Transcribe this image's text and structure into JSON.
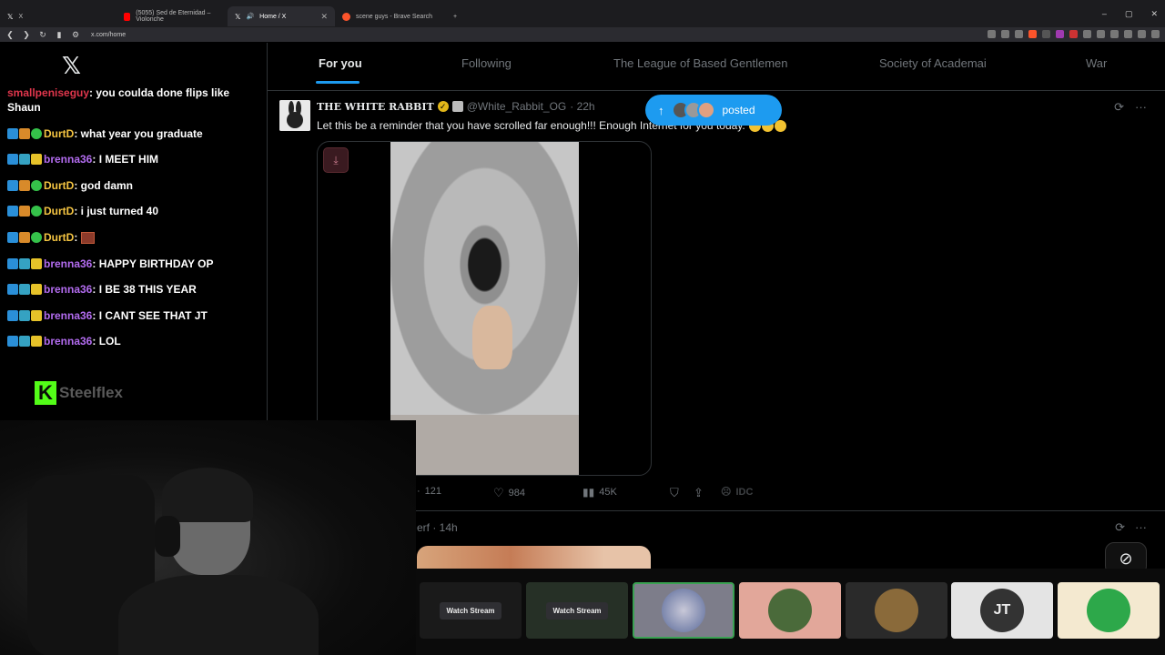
{
  "browser": {
    "tabs": [
      {
        "label": "X",
        "favicon_color": "#000000",
        "active": false
      },
      {
        "label": "(5055) Sed de Eternidad – Violonche",
        "favicon_color": "#ff0000",
        "active": false
      },
      {
        "label": "Home / X",
        "favicon_color": "#000000",
        "active": true
      },
      {
        "label": "scene guys - Brave Search",
        "favicon_color": "#fb542b",
        "active": false
      }
    ],
    "new_tab": "+",
    "url": "x.com/home"
  },
  "chat": {
    "platform": "Steelflex",
    "messages": [
      {
        "user": "smallpeniseguy",
        "text": ": you coulda done flips like",
        "user_color": "#e0364c"
      },
      {
        "user": "",
        "text": "Shaun",
        "user_color": "#ffffff"
      },
      {
        "user": "DurtD",
        "text": ": what year you graduate",
        "user_color": "#f5c542"
      },
      {
        "user": "brenna36",
        "text": ": I MEET HIM",
        "user_color": "#b36cf0"
      },
      {
        "user": "DurtD",
        "text": ": god damn",
        "user_color": "#f5c542"
      },
      {
        "user": "DurtD",
        "text": ": i just turned 40",
        "user_color": "#f5c542"
      },
      {
        "user": "DurtD",
        "text": ":",
        "user_color": "#f5c542"
      },
      {
        "user": "brenna36",
        "text": ": HAPPY BIRTHDAY OP",
        "user_color": "#b36cf0"
      },
      {
        "user": "brenna36",
        "text": ": I BE 38 THIS YEAR",
        "user_color": "#b36cf0"
      },
      {
        "user": "brenna36",
        "text": ": I CANT SEE THAT JT",
        "user_color": "#b36cf0"
      },
      {
        "user": "brenna36",
        "text": ": LOL",
        "user_color": "#b36cf0"
      }
    ]
  },
  "x": {
    "tabs": [
      "For you",
      "Following",
      "The League of Based Gentlemen",
      "Society of Academai",
      "War"
    ],
    "active_tab": "For you",
    "posted_pill": "posted",
    "tweet": {
      "name": "THE WHITE RABBIT",
      "handle": "@White_Rabbit_OG",
      "time": "· 22h",
      "text": "Let this be a reminder that you have scrolled far enough!!! Enough Internet for you today.",
      "replies": "121",
      "likes": "984",
      "views": "45K",
      "idc": "IDC"
    },
    "tweet2": {
      "head": "erf · 14h"
    }
  },
  "stream_bar": {
    "watch_label": "Watch Stream",
    "thumbs": [
      {
        "kind": "watch",
        "bg": "#1a1a1a"
      },
      {
        "kind": "watch",
        "bg": "#263026"
      },
      {
        "kind": "circle",
        "bg": "#7d7d8a",
        "circle": "#5a6a9a",
        "selected": true
      },
      {
        "kind": "circle",
        "bg": "#e2a79a",
        "circle": "#4a6a3a"
      },
      {
        "kind": "circle",
        "bg": "#2a2a2a",
        "circle": "#8a6a3a"
      },
      {
        "kind": "circle",
        "bg": "#e4e4e4",
        "circle": "#333333",
        "text": "JT"
      },
      {
        "kind": "circle",
        "bg": "#f4e9d0",
        "circle": "#2da84a"
      }
    ]
  },
  "colors": {
    "x_blue": "#1d9bf0",
    "kick_green": "#53fc18"
  }
}
